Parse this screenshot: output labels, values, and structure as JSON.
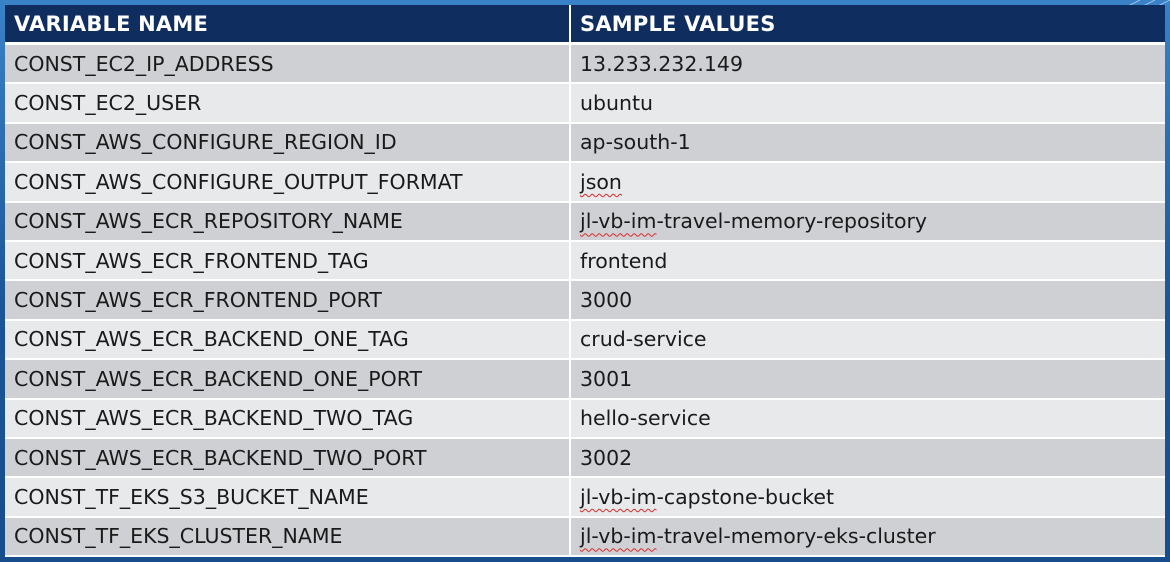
{
  "table": {
    "headers": [
      "VARIABLE NAME",
      "SAMPLE VALUES"
    ],
    "rows": [
      {
        "name": "CONST_EC2_IP_ADDRESS",
        "value": "13.233.232.149"
      },
      {
        "name": "CONST_EC2_USER",
        "value": "ubuntu"
      },
      {
        "name": "CONST_AWS_CONFIGURE_REGION_ID",
        "value": "ap-south-1"
      },
      {
        "name": "CONST_AWS_CONFIGURE_OUTPUT_FORMAT",
        "value_spell": "json",
        "value_rest": ""
      },
      {
        "name": "CONST_AWS_ECR_REPOSITORY_NAME",
        "value_spell": "jl-vb-im",
        "value_rest": "-travel-memory-repository"
      },
      {
        "name": "CONST_AWS_ECR_FRONTEND_TAG",
        "value": "frontend"
      },
      {
        "name": "CONST_AWS_ECR_FRONTEND_PORT",
        "value": "3000"
      },
      {
        "name": "CONST_AWS_ECR_BACKEND_ONE_TAG",
        "value": "crud-service"
      },
      {
        "name": "CONST_AWS_ECR_BACKEND_ONE_PORT",
        "value": "3001"
      },
      {
        "name": "CONST_AWS_ECR_BACKEND_TWO_TAG",
        "value": "hello-service"
      },
      {
        "name": "CONST_AWS_ECR_BACKEND_TWO_PORT",
        "value": "3002"
      },
      {
        "name": "CONST_TF_EKS_S3_BUCKET_NAME",
        "value_spell": "jl-vb-im",
        "value_rest": "-capstone-bucket"
      },
      {
        "name": "CONST_TF_EKS_CLUSTER_NAME",
        "value_spell": "jl-vb-im",
        "value_rest": "-travel-memory-eks-cluster"
      }
    ]
  },
  "colors": {
    "header_bg": "#0f2d5e",
    "row_dark": "#cfd0d3",
    "row_light": "#e8e9eb",
    "frame": "#1d5aa0"
  }
}
